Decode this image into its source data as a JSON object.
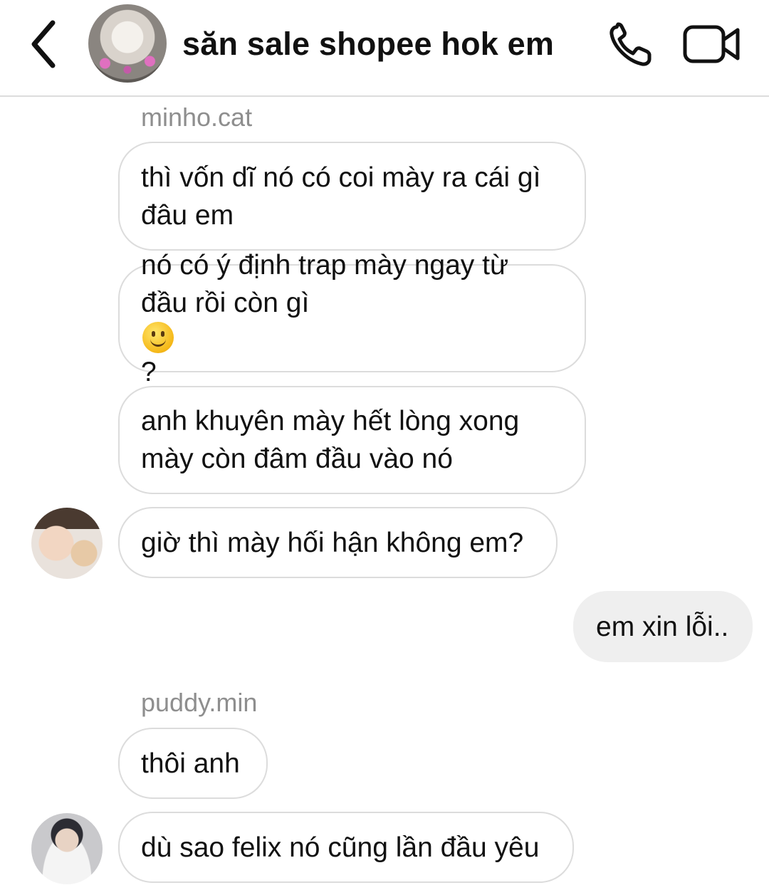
{
  "header": {
    "title": "săn sale shopee hok em",
    "back_icon": "chevron-left-icon",
    "call_icon": "phone-icon",
    "video_icon": "video-camera-icon"
  },
  "messages": [
    {
      "type": "sender",
      "text": "minho.cat"
    },
    {
      "type": "incoming",
      "lines": [
        "thì vốn dĩ nó có coi mày ra cái gì",
        "đâu em"
      ]
    },
    {
      "type": "incoming",
      "lines": [
        "nó có ý định trap mày ngay từ",
        "đầu rồi còn gì",
        "?"
      ],
      "emoji": "slightly-smiling-face-emoji"
    },
    {
      "type": "incoming",
      "lines": [
        "anh khuyên mày hết lòng xong",
        "mày còn đâm đầu vào nó"
      ]
    },
    {
      "type": "incoming",
      "lines": [
        "giờ thì mày hối hận không em?"
      ]
    },
    {
      "type": "outgoing",
      "lines": [
        "em xin lỗi.."
      ]
    },
    {
      "type": "sender",
      "text": "puddy.min"
    },
    {
      "type": "incoming",
      "lines": [
        "thôi anh"
      ]
    },
    {
      "type": "incoming",
      "lines": [
        "dù sao felix nó cũng lần đầu yêu"
      ]
    }
  ]
}
